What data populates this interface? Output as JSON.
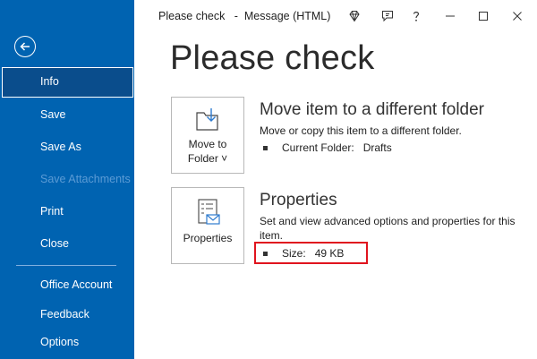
{
  "sidebar": {
    "back_icon": "back-arrow-icon",
    "items": [
      {
        "label": "Info",
        "active": true
      },
      {
        "label": "Save"
      },
      {
        "label": "Save As"
      },
      {
        "label": "Save Attachments",
        "disabled": true
      },
      {
        "label": "Print"
      },
      {
        "label": "Close"
      },
      {
        "label": "Office Account"
      },
      {
        "label": "Feedback"
      },
      {
        "label": "Options"
      }
    ]
  },
  "titlebar": {
    "title": "Please check   -  Message (HTML)",
    "icons": [
      "diamond-icon",
      "comment-icon",
      "help-icon",
      "minimize-icon",
      "maximize-icon",
      "close-icon"
    ]
  },
  "main": {
    "heading": "Please check",
    "move": {
      "button_label_line1": "Move to",
      "button_label_line2": "Folder ˅",
      "title": "Move item to a different folder",
      "description": "Move or copy this item to a different folder.",
      "current_folder_label": "Current Folder:",
      "current_folder_value": "Drafts"
    },
    "properties": {
      "button_label": "Properties",
      "title": "Properties",
      "description_line1": "Set and view advanced options and properties for this",
      "description_line2": "item.",
      "size_label": "Size:",
      "size_value": "49 KB"
    }
  },
  "colors": {
    "sidebar_bg": "#0063b1",
    "sidebar_active": "#0a4d8c",
    "highlight": "#e0141e"
  }
}
